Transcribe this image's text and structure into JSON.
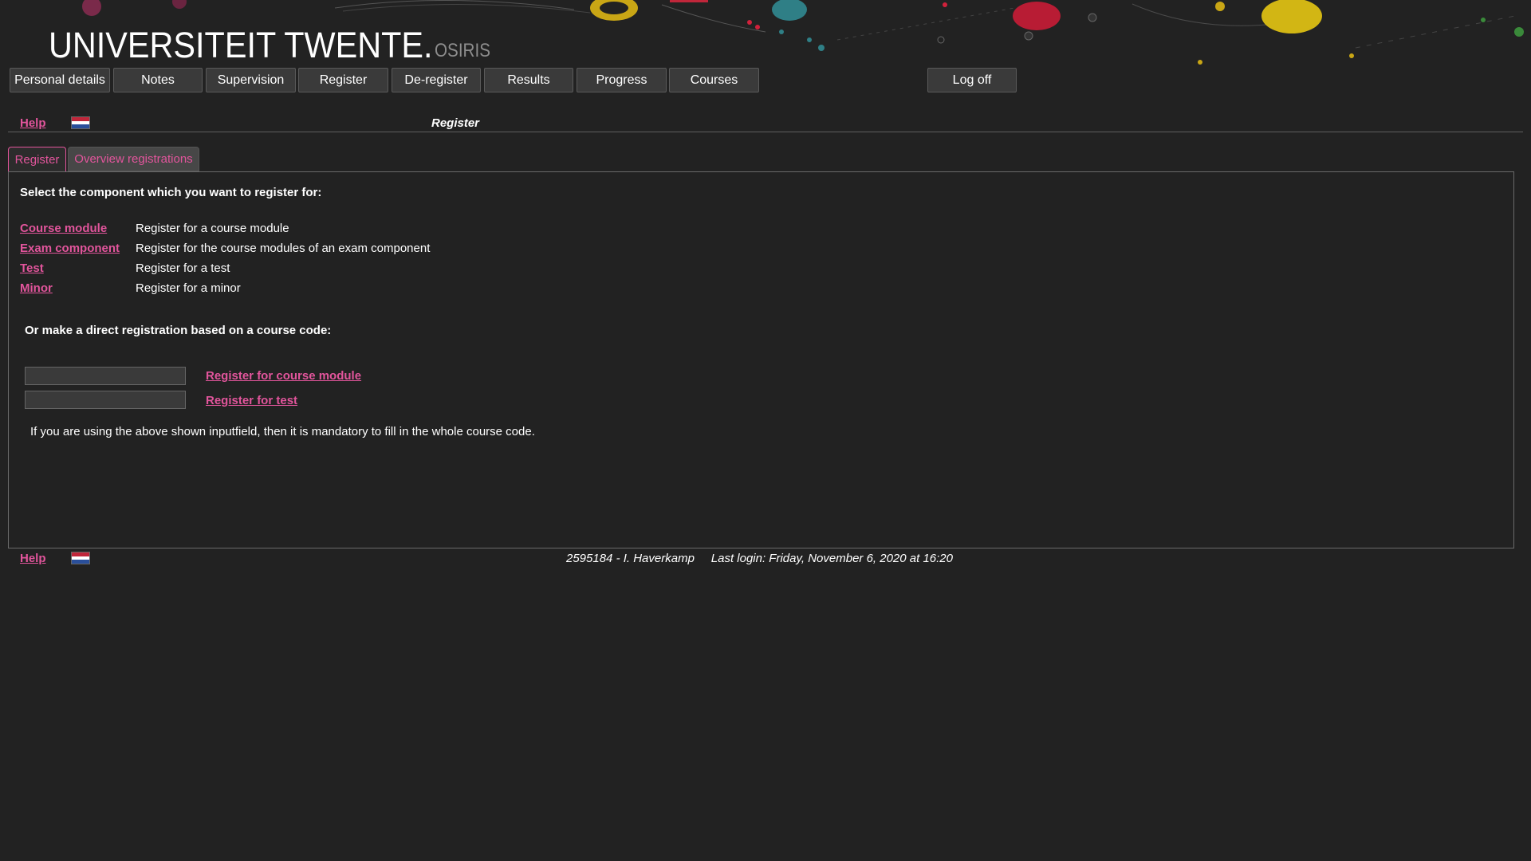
{
  "header": {
    "logo_text": "UNIVERSITEIT TWENTE.",
    "app_name": "OSIRIS"
  },
  "nav": {
    "items": [
      {
        "label": "Personal details"
      },
      {
        "label": "Notes"
      },
      {
        "label": "Supervision"
      },
      {
        "label": "Register"
      },
      {
        "label": "De-register"
      },
      {
        "label": "Results"
      },
      {
        "label": "Progress"
      },
      {
        "label": "Courses"
      }
    ],
    "logoff_label": "Log off"
  },
  "help": {
    "label": "Help",
    "language_flag_icon": "dutch-flag-icon"
  },
  "page_title": "Register",
  "tabs": [
    {
      "label": "Register",
      "active": true
    },
    {
      "label": "Overview registrations",
      "active": false
    }
  ],
  "main": {
    "select_heading": "Select the component which you want to register for:",
    "options": [
      {
        "link": "Course module",
        "description": "Register for a course module"
      },
      {
        "link": "Exam component",
        "description": "Register for the course modules of an exam component"
      },
      {
        "link": "Test",
        "description": "Register for a test"
      },
      {
        "link": "Minor",
        "description": "Register for a minor"
      }
    ],
    "direct_heading": "Or make a direct registration based on a course code:",
    "direct": [
      {
        "input_value": "",
        "link": "Register for course module"
      },
      {
        "input_value": "",
        "link": "Register for test"
      }
    ],
    "note": "If you are using the above shown inputfield, then it is mandatory to fill in the whole course code."
  },
  "footer": {
    "user": "2595184 - I. Haverkamp",
    "last_login": "Last login: Friday, November 6, 2020 at 16:20"
  },
  "colors": {
    "background": "#222222",
    "accent": "#e2559c",
    "button": "#3a3a3a"
  }
}
